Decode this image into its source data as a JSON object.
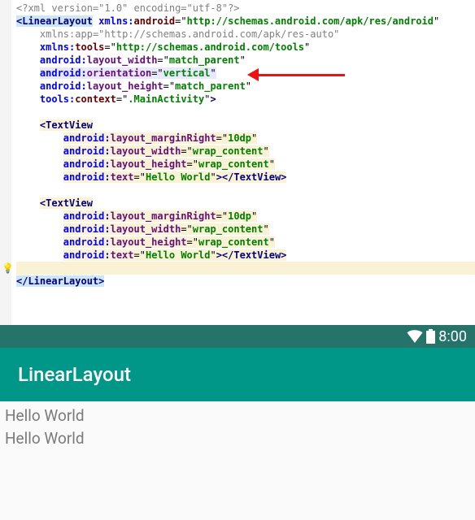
{
  "xml_decl": "<?xml version=\"1.0\" encoding=\"utf-8\"?>",
  "root": {
    "open": "<",
    "name": "LinearLayout",
    "close_open": ">",
    "close": "</",
    "close_name": "LinearLayout",
    "close_end": ">",
    "attrs": [
      {
        "ns": "xmlns",
        "key": "android",
        "val": "http://schemas.android.com/apk/res/android"
      },
      {
        "ns": "xmlns",
        "key": "app",
        "val": "http://schemas.android.com/apk/res-auto",
        "comment": true
      },
      {
        "ns": "xmlns",
        "key": "tools",
        "val": "http://schemas.android.com/tools"
      },
      {
        "ns": "android",
        "key": "layout_width",
        "val": "match_parent"
      },
      {
        "ns": "android",
        "key": "orientation",
        "val": "vertical",
        "hl": true
      },
      {
        "ns": "android",
        "key": "layout_height",
        "val": "match_parent"
      },
      {
        "ns": "tools",
        "key": "context",
        "val": ".MainActivity"
      }
    ]
  },
  "child": {
    "open": "<",
    "name": "TextView",
    "close": "></",
    "close_name": "TextView",
    "close_end": ">",
    "attrs": [
      {
        "ns": "android",
        "key": "layout_marginRight",
        "val": "10dp"
      },
      {
        "ns": "android",
        "key": "layout_width",
        "val": "wrap_content"
      },
      {
        "ns": "android",
        "key": "layout_height",
        "val": "wrap_content"
      },
      {
        "ns": "android",
        "key": "text",
        "val": "Hello World"
      }
    ]
  },
  "device": {
    "time": "8:00",
    "title": "LinearLayout",
    "items": [
      "Hello World",
      "Hello World"
    ]
  }
}
